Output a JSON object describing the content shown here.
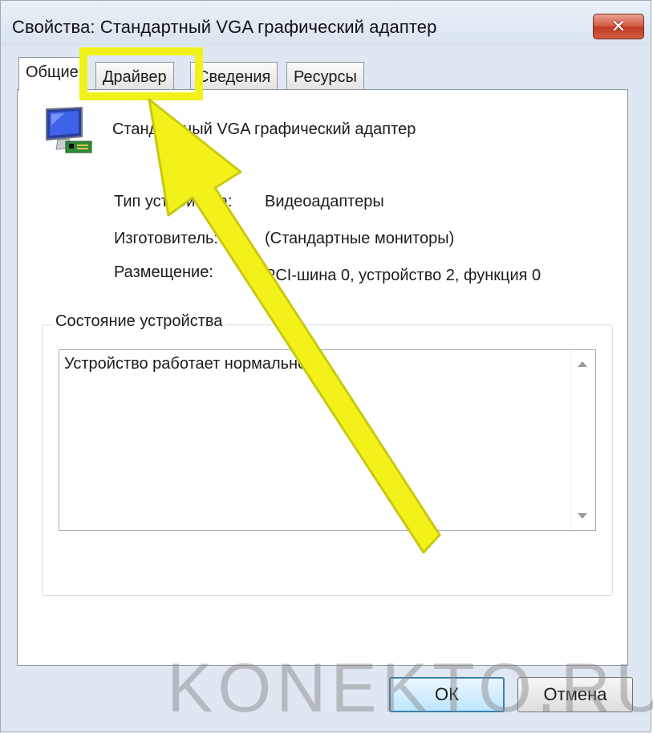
{
  "window": {
    "title": "Свойства: Стандартный VGA графический адаптер",
    "close_label": "✕"
  },
  "tabs": [
    {
      "label": "Общие",
      "active": true
    },
    {
      "label": "Драйвер",
      "active": false
    },
    {
      "label": "Сведения",
      "active": false
    },
    {
      "label": "Ресурсы",
      "active": false
    }
  ],
  "device": {
    "name": "Стандартный VGA графический адаптер",
    "icon": "display-adapter-icon"
  },
  "properties": [
    {
      "label": "Тип устройства:",
      "value": "Видеоадаптеры"
    },
    {
      "label": "Изготовитель:",
      "value": "(Стандартные мониторы)"
    },
    {
      "label": "Размещение:",
      "value": "PCI-шина 0, устройство 2, функция 0"
    }
  ],
  "status_group": {
    "title": "Состояние устройства",
    "text": "Устройство работает нормально."
  },
  "buttons": {
    "ok_label": "ОК",
    "cancel_label": "Отмена"
  },
  "annotation": {
    "highlight_color": "#f2f21a",
    "watermark": "KONEKTO.RU"
  }
}
